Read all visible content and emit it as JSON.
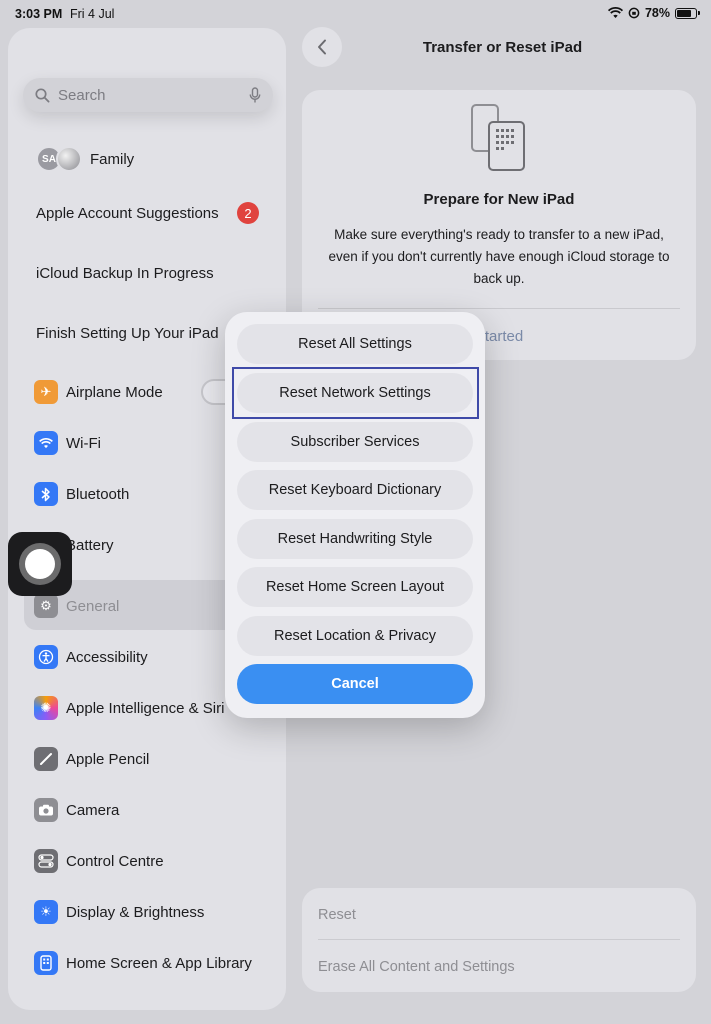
{
  "status_bar": {
    "time": "3:03 PM",
    "date": "Fri 4 Jul",
    "battery": "78%",
    "battery_level": 0.78
  },
  "sidebar": {
    "search_placeholder": "Search",
    "family": {
      "initials": "SA",
      "label": "Family"
    },
    "account_suggestions": {
      "label": "Apple Account Suggestions",
      "badge": "2"
    },
    "icloud_backup": "iCloud Backup In Progress",
    "finish_setup": "Finish Setting Up Your iPad",
    "items": [
      {
        "label": "Airplane Mode",
        "icon": "airplane-icon",
        "color": "#f09a37"
      },
      {
        "label": "Wi-Fi",
        "icon": "wifi-icon",
        "color": "#3478f6"
      },
      {
        "label": "Bluetooth",
        "icon": "bluetooth-icon",
        "color": "#3478f6"
      },
      {
        "label": "Battery",
        "icon": "battery-icon",
        "color": "#4cd964"
      },
      {
        "label": "General",
        "icon": "gear-icon",
        "color": "#8e8e93"
      },
      {
        "label": "Accessibility",
        "icon": "accessibility-icon",
        "color": "#3478f6"
      },
      {
        "label": "Apple Intelligence & Siri",
        "icon": "siri-icon",
        "color": "#8b5cf6"
      },
      {
        "label": "Apple Pencil",
        "icon": "pencil-icon",
        "color": "#6e6e73"
      },
      {
        "label": "Camera",
        "icon": "camera-icon",
        "color": "#8e8e93"
      },
      {
        "label": "Control Centre",
        "icon": "control-centre-icon",
        "color": "#6e6e73"
      },
      {
        "label": "Display & Brightness",
        "icon": "brightness-icon",
        "color": "#3478f6"
      },
      {
        "label": "Home Screen & App Library",
        "icon": "home-screen-icon",
        "color": "#3478f6"
      }
    ]
  },
  "detail": {
    "title": "Transfer or Reset iPad",
    "prepare": {
      "title": "Prepare for New iPad",
      "description": "Make sure everything's ready to transfer to a new iPad, even if you don't currently have enough iCloud storage to back up.",
      "link": "Started"
    },
    "reset_section": {
      "reset": "Reset",
      "erase": "Erase All Content and Settings"
    }
  },
  "reset_menu": {
    "options": [
      "Reset All Settings",
      "Reset Network Settings",
      "Subscriber Services",
      "Reset Keyboard Dictionary",
      "Reset Handwriting Style",
      "Reset Home Screen Layout",
      "Reset Location & Privacy"
    ],
    "cancel": "Cancel",
    "highlighted": "Reset Network Settings"
  },
  "colors": {
    "accent": "#3a8ff2",
    "badge": "#e0433e",
    "highlight_border": "#3f4aa8"
  }
}
